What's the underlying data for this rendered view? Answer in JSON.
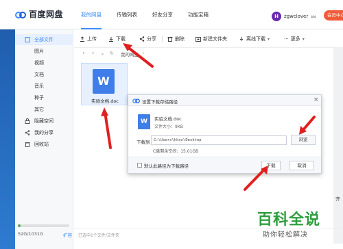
{
  "app": {
    "logo_text": "百度网盘"
  },
  "nav": [
    "我的网盘",
    "传输列表",
    "好友分享",
    "功能宝箱"
  ],
  "user": {
    "name": "zgwclover",
    "vip_button": "会员中心"
  },
  "sidebar": {
    "items": [
      {
        "label": "全部文件",
        "icon": "folder-icon",
        "active": true
      },
      {
        "label": "图片",
        "icon": "none",
        "active": false
      },
      {
        "label": "视频",
        "icon": "none",
        "active": false
      },
      {
        "label": "文档",
        "icon": "none",
        "active": false
      },
      {
        "label": "音乐",
        "icon": "none",
        "active": false
      },
      {
        "label": "种子",
        "icon": "none",
        "active": false
      },
      {
        "label": "其它",
        "icon": "none",
        "active": false
      },
      {
        "label": "隐藏空间",
        "icon": "lock-icon",
        "active": false
      },
      {
        "label": "我的分享",
        "icon": "share-icon",
        "active": false
      },
      {
        "label": "回收站",
        "icon": "trash-icon",
        "active": false
      }
    ],
    "quota_text": "52G/1031G",
    "expand_label": "扩容",
    "quota_used_fraction": 0.05
  },
  "toolbar": {
    "upload": "上传",
    "download": "下载",
    "share": "分享",
    "delete": "删除",
    "new_folder": "新建文件夹",
    "offline_download": "离线下载",
    "more": "更多"
  },
  "breadcrumb": {
    "text": "我的网盘"
  },
  "file": {
    "name": "实验文档.doc",
    "icon_letter": "W"
  },
  "right_edge_text": "齐",
  "status_text": "已选中1个文件/文件夹",
  "dialog": {
    "title": "设置下载存储路径",
    "file_name": "实验文档.doc",
    "file_size": "文件大小：9KB",
    "download_to_label": "下载到",
    "path": "C:\\Users\\hhxx\\Desktop",
    "browse": "浏览",
    "free_space": "C盘剩余空间：15.01GB",
    "default_checkbox": "默认此路径为下载路径",
    "download_button": "下载",
    "cancel_button": "取消"
  },
  "watermark": {
    "big": "百科全说",
    "small": "助你轻松解决"
  },
  "colors": {
    "accent": "#3b8cff",
    "vip": "#f25b3a",
    "arrow": "#e02020",
    "watermark": "#2e9e3e"
  }
}
